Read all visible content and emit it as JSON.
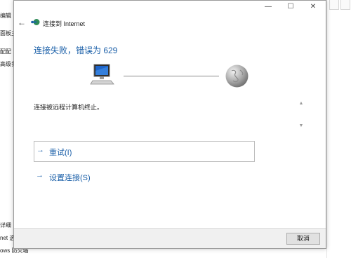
{
  "background": {
    "left_texts": [
      "编辑",
      "面板主",
      "配配",
      "高级扌",
      "详细",
      "net 选",
      "ows 防火墙"
    ]
  },
  "dialog": {
    "title": "连接到 Internet",
    "controls": {
      "minimize": "—",
      "maximize": "☐",
      "close": "✕"
    },
    "error_heading": "连接失败，错误为 629",
    "message": "连接被远程计算机终止。",
    "retry_label": "重试(I)",
    "setup_label": "设置连接(S)",
    "cancel_label": "取消",
    "colors": {
      "accent": "#1a5fa8",
      "text": "#222222",
      "line": "#8a8a8a"
    }
  }
}
